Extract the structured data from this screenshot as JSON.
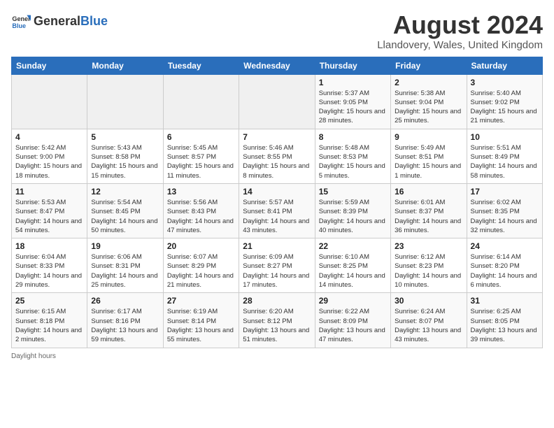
{
  "header": {
    "logo_general": "General",
    "logo_blue": "Blue",
    "month_year": "August 2024",
    "location": "Llandovery, Wales, United Kingdom"
  },
  "days_of_week": [
    "Sunday",
    "Monday",
    "Tuesday",
    "Wednesday",
    "Thursday",
    "Friday",
    "Saturday"
  ],
  "footer": {
    "note": "Daylight hours"
  },
  "weeks": [
    [
      {
        "day": "",
        "sunrise": "",
        "sunset": "",
        "daylight": ""
      },
      {
        "day": "",
        "sunrise": "",
        "sunset": "",
        "daylight": ""
      },
      {
        "day": "",
        "sunrise": "",
        "sunset": "",
        "daylight": ""
      },
      {
        "day": "",
        "sunrise": "",
        "sunset": "",
        "daylight": ""
      },
      {
        "day": "1",
        "sunrise": "Sunrise: 5:37 AM",
        "sunset": "Sunset: 9:05 PM",
        "daylight": "Daylight: 15 hours and 28 minutes."
      },
      {
        "day": "2",
        "sunrise": "Sunrise: 5:38 AM",
        "sunset": "Sunset: 9:04 PM",
        "daylight": "Daylight: 15 hours and 25 minutes."
      },
      {
        "day": "3",
        "sunrise": "Sunrise: 5:40 AM",
        "sunset": "Sunset: 9:02 PM",
        "daylight": "Daylight: 15 hours and 21 minutes."
      }
    ],
    [
      {
        "day": "4",
        "sunrise": "Sunrise: 5:42 AM",
        "sunset": "Sunset: 9:00 PM",
        "daylight": "Daylight: 15 hours and 18 minutes."
      },
      {
        "day": "5",
        "sunrise": "Sunrise: 5:43 AM",
        "sunset": "Sunset: 8:58 PM",
        "daylight": "Daylight: 15 hours and 15 minutes."
      },
      {
        "day": "6",
        "sunrise": "Sunrise: 5:45 AM",
        "sunset": "Sunset: 8:57 PM",
        "daylight": "Daylight: 15 hours and 11 minutes."
      },
      {
        "day": "7",
        "sunrise": "Sunrise: 5:46 AM",
        "sunset": "Sunset: 8:55 PM",
        "daylight": "Daylight: 15 hours and 8 minutes."
      },
      {
        "day": "8",
        "sunrise": "Sunrise: 5:48 AM",
        "sunset": "Sunset: 8:53 PM",
        "daylight": "Daylight: 15 hours and 5 minutes."
      },
      {
        "day": "9",
        "sunrise": "Sunrise: 5:49 AM",
        "sunset": "Sunset: 8:51 PM",
        "daylight": "Daylight: 15 hours and 1 minute."
      },
      {
        "day": "10",
        "sunrise": "Sunrise: 5:51 AM",
        "sunset": "Sunset: 8:49 PM",
        "daylight": "Daylight: 14 hours and 58 minutes."
      }
    ],
    [
      {
        "day": "11",
        "sunrise": "Sunrise: 5:53 AM",
        "sunset": "Sunset: 8:47 PM",
        "daylight": "Daylight: 14 hours and 54 minutes."
      },
      {
        "day": "12",
        "sunrise": "Sunrise: 5:54 AM",
        "sunset": "Sunset: 8:45 PM",
        "daylight": "Daylight: 14 hours and 50 minutes."
      },
      {
        "day": "13",
        "sunrise": "Sunrise: 5:56 AM",
        "sunset": "Sunset: 8:43 PM",
        "daylight": "Daylight: 14 hours and 47 minutes."
      },
      {
        "day": "14",
        "sunrise": "Sunrise: 5:57 AM",
        "sunset": "Sunset: 8:41 PM",
        "daylight": "Daylight: 14 hours and 43 minutes."
      },
      {
        "day": "15",
        "sunrise": "Sunrise: 5:59 AM",
        "sunset": "Sunset: 8:39 PM",
        "daylight": "Daylight: 14 hours and 40 minutes."
      },
      {
        "day": "16",
        "sunrise": "Sunrise: 6:01 AM",
        "sunset": "Sunset: 8:37 PM",
        "daylight": "Daylight: 14 hours and 36 minutes."
      },
      {
        "day": "17",
        "sunrise": "Sunrise: 6:02 AM",
        "sunset": "Sunset: 8:35 PM",
        "daylight": "Daylight: 14 hours and 32 minutes."
      }
    ],
    [
      {
        "day": "18",
        "sunrise": "Sunrise: 6:04 AM",
        "sunset": "Sunset: 8:33 PM",
        "daylight": "Daylight: 14 hours and 29 minutes."
      },
      {
        "day": "19",
        "sunrise": "Sunrise: 6:06 AM",
        "sunset": "Sunset: 8:31 PM",
        "daylight": "Daylight: 14 hours and 25 minutes."
      },
      {
        "day": "20",
        "sunrise": "Sunrise: 6:07 AM",
        "sunset": "Sunset: 8:29 PM",
        "daylight": "Daylight: 14 hours and 21 minutes."
      },
      {
        "day": "21",
        "sunrise": "Sunrise: 6:09 AM",
        "sunset": "Sunset: 8:27 PM",
        "daylight": "Daylight: 14 hours and 17 minutes."
      },
      {
        "day": "22",
        "sunrise": "Sunrise: 6:10 AM",
        "sunset": "Sunset: 8:25 PM",
        "daylight": "Daylight: 14 hours and 14 minutes."
      },
      {
        "day": "23",
        "sunrise": "Sunrise: 6:12 AM",
        "sunset": "Sunset: 8:23 PM",
        "daylight": "Daylight: 14 hours and 10 minutes."
      },
      {
        "day": "24",
        "sunrise": "Sunrise: 6:14 AM",
        "sunset": "Sunset: 8:20 PM",
        "daylight": "Daylight: 14 hours and 6 minutes."
      }
    ],
    [
      {
        "day": "25",
        "sunrise": "Sunrise: 6:15 AM",
        "sunset": "Sunset: 8:18 PM",
        "daylight": "Daylight: 14 hours and 2 minutes."
      },
      {
        "day": "26",
        "sunrise": "Sunrise: 6:17 AM",
        "sunset": "Sunset: 8:16 PM",
        "daylight": "Daylight: 13 hours and 59 minutes."
      },
      {
        "day": "27",
        "sunrise": "Sunrise: 6:19 AM",
        "sunset": "Sunset: 8:14 PM",
        "daylight": "Daylight: 13 hours and 55 minutes."
      },
      {
        "day": "28",
        "sunrise": "Sunrise: 6:20 AM",
        "sunset": "Sunset: 8:12 PM",
        "daylight": "Daylight: 13 hours and 51 minutes."
      },
      {
        "day": "29",
        "sunrise": "Sunrise: 6:22 AM",
        "sunset": "Sunset: 8:09 PM",
        "daylight": "Daylight: 13 hours and 47 minutes."
      },
      {
        "day": "30",
        "sunrise": "Sunrise: 6:24 AM",
        "sunset": "Sunset: 8:07 PM",
        "daylight": "Daylight: 13 hours and 43 minutes."
      },
      {
        "day": "31",
        "sunrise": "Sunrise: 6:25 AM",
        "sunset": "Sunset: 8:05 PM",
        "daylight": "Daylight: 13 hours and 39 minutes."
      }
    ]
  ]
}
